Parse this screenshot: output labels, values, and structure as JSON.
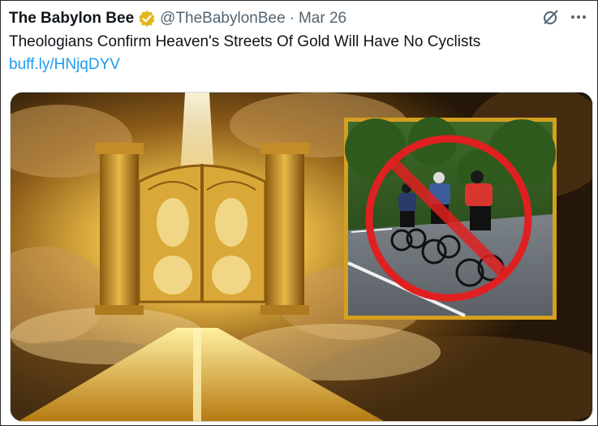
{
  "tweet": {
    "display_name": "The Babylon Bee",
    "handle": "@TheBabylonBee",
    "separator": "·",
    "date": "Mar 26",
    "text": "Theologians Confirm Heaven's Streets Of Gold Will Have No Cyclists",
    "link": "buff.ly/HNjqDYV"
  },
  "icons": {
    "verified": "verified-gold-badge-icon",
    "grok": "grok-icon",
    "more": "more-options-icon",
    "no_symbol": "prohibition-icon"
  },
  "colors": {
    "name": "#0f1419",
    "secondary": "#536471",
    "link": "#1d9bf0",
    "badge": "#e2b719",
    "prohibition": "#e02020",
    "inset_border": "#d4a020"
  }
}
